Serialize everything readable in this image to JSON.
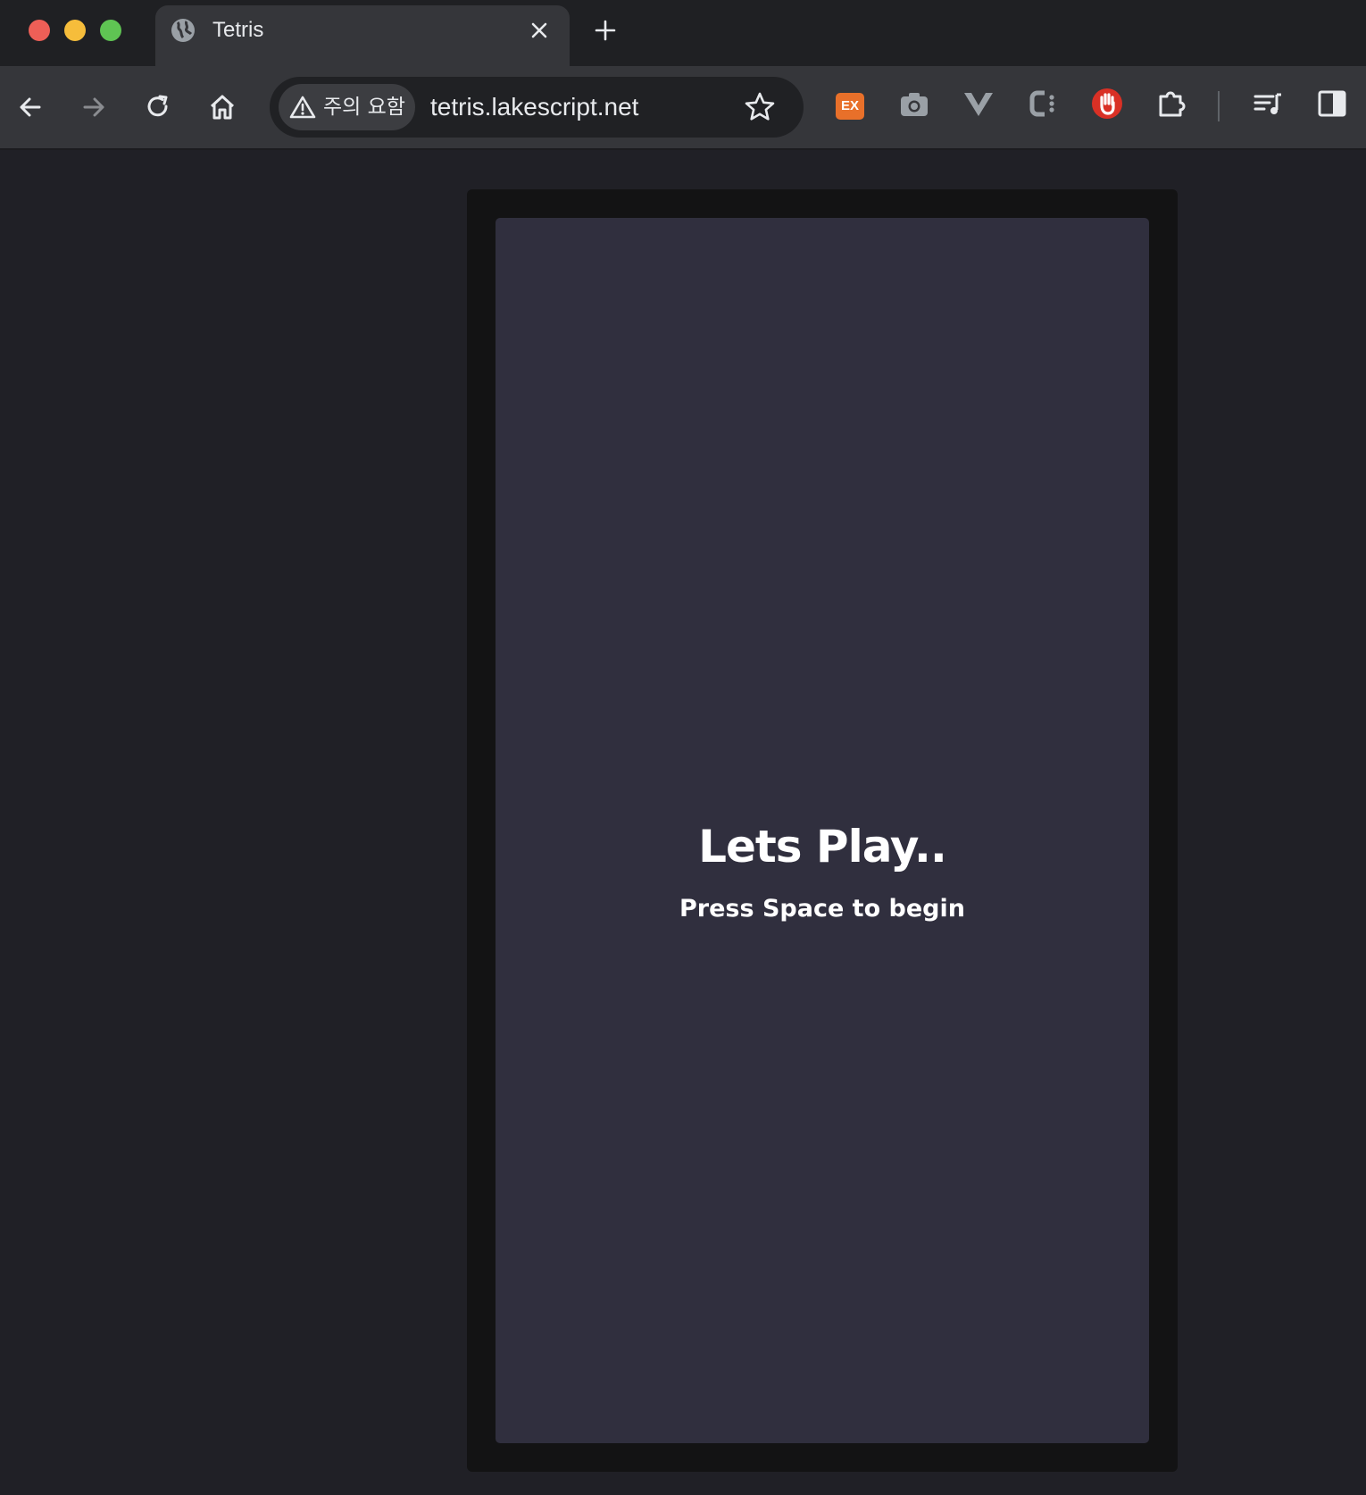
{
  "browser": {
    "tab": {
      "title": "Tetris",
      "icon": "globe-icon"
    },
    "new_tab_icon": "plus-icon",
    "toolbar": {
      "back_icon": "arrow-left-icon",
      "forward_icon": "arrow-right-icon",
      "reload_icon": "reload-icon",
      "home_icon": "home-icon"
    },
    "omnibox": {
      "security_label": "주의 요함",
      "security_icon": "warning-triangle-icon",
      "url": "tetris.lakescript.net",
      "bookmark_icon": "star-icon"
    },
    "extensions": [
      {
        "name": "ex-extension-icon",
        "label": "EX",
        "color": "#e8702a"
      },
      {
        "name": "camera-extension-icon"
      },
      {
        "name": "vue-devtools-extension-icon"
      },
      {
        "name": "c-extension-icon"
      },
      {
        "name": "stop-hand-extension-icon",
        "color": "#d93025"
      },
      {
        "name": "extensions-puzzle-icon"
      }
    ],
    "media_icon": "media-queue-icon",
    "side_panel_icon": "side-panel-icon"
  },
  "game": {
    "title": "Lets Play..",
    "subtitle": "Press Space to begin",
    "colors": {
      "page_background": "#202026",
      "frame": "#131314",
      "board": "#302f3e",
      "text": "#ffffff"
    }
  }
}
